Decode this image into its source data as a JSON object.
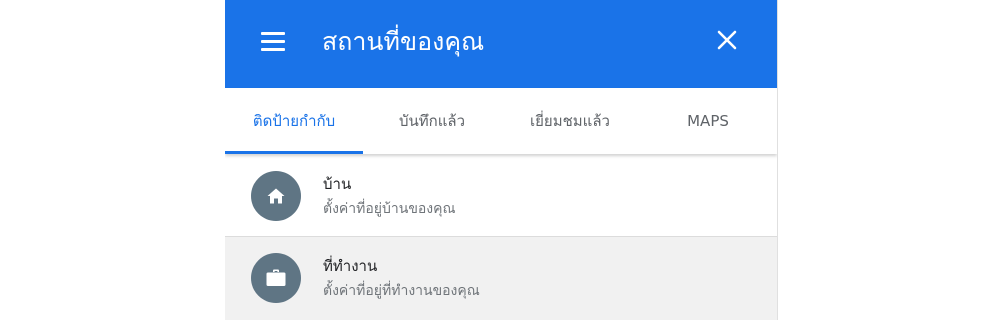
{
  "header": {
    "title": "สถานที่ของคุณ",
    "menu_icon": "menu-icon",
    "close_icon": "close-icon",
    "background_color": "#1a73e8"
  },
  "tabs": [
    {
      "label": "ติดป้ายกำกับ",
      "active": true
    },
    {
      "label": "บันทึกแล้ว",
      "active": false
    },
    {
      "label": "เยี่ยมชมแล้ว",
      "active": false
    },
    {
      "label": "MAPS",
      "active": false
    }
  ],
  "places": [
    {
      "icon": "home-icon",
      "title": "บ้าน",
      "subtitle": "ตั้งค่าที่อยู่บ้านของคุณ"
    },
    {
      "icon": "briefcase-icon",
      "title": "ที่ทำงาน",
      "subtitle": "ตั้งค่าที่อยู่ที่ทำงานของคุณ"
    }
  ],
  "colors": {
    "accent": "#1a73e8",
    "avatar": "#5f7584"
  }
}
